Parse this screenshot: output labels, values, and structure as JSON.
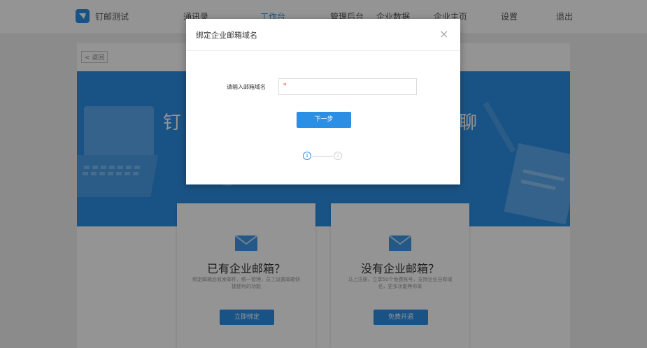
{
  "header": {
    "app_name": "钉邮测试",
    "nav": [
      "通讯录",
      "工作台",
      "管理后台",
      "企业数据",
      "企业主页",
      "设置",
      "退出"
    ],
    "active_nav_index": 1
  },
  "main": {
    "back_label": "< 返回",
    "banner": {
      "title_left": "钉",
      "title_right": "聊"
    },
    "cards": [
      {
        "title": "已有企业邮箱？",
        "desc": "绑定邮箱后收发邮件，统一管理，员工设置邮箱快捷便利的功能",
        "button": "立即绑定"
      },
      {
        "title": "没有企业邮箱？",
        "desc": "马上注册，立享50个免费账号，支持企业自有域名，更多功能等你来",
        "button": "免费开通"
      }
    ]
  },
  "modal": {
    "title": "绑定企业邮箱域名",
    "close_glyph": "×",
    "field_label": "请输入邮箱域名",
    "required_mark": "*",
    "input_value": "",
    "next_label": "下一步",
    "steps": [
      "1",
      "2"
    ],
    "current_step": 1
  },
  "colors": {
    "accent": "#2b8fe6",
    "overlay": "rgba(0,0,0,0.42)"
  }
}
